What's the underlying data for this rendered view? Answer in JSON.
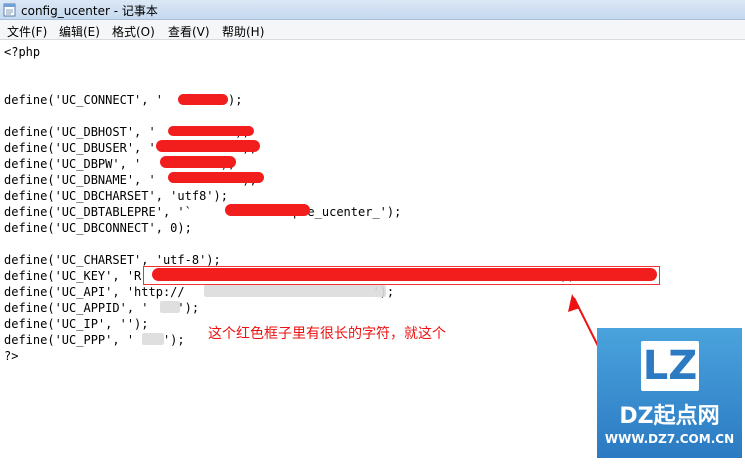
{
  "window": {
    "title": "config_ucenter - 记事本"
  },
  "menu": {
    "items": [
      "文件(F)",
      "编辑(E)",
      "格式(O)",
      "查看(V)",
      "帮助(H)"
    ]
  },
  "code": {
    "lines": [
      "<?php",
      "",
      "",
      "define('UC_CONNECT', '        ');",
      "",
      "define('UC_DBHOST', '          ');",
      "define('UC_DBUSER', '           ');",
      "define('UC_DBPW', '          ');",
      "define('UC_DBNAME', '           ');",
      "define('UC_DBCHARSET', 'utf8');",
      "define('UC_DBTABLEPRE', '`             .pre_ucenter_');",
      "define('UC_DBCONNECT', 0);",
      "",
      "define('UC_CHARSET', 'utf-8');",
      "define('UC_KEY', 'R                                                         ');",
      "define('UC_API', 'http://                          ');",
      "define('UC_APPID', '    ');",
      "define('UC_IP', '');",
      "define('UC_PPP', '    ');",
      "?>"
    ]
  },
  "annotation": {
    "text": "这个红色框子里有很长的字符，就这个"
  },
  "watermark": {
    "badge": "LZ",
    "name": "DZ起点网",
    "url": "WWW.DZ7.COM.CN"
  },
  "colors": {
    "redaction": "#f21d1d",
    "annotation": "#ee1111",
    "logo_blue": "#2b7ac2"
  }
}
